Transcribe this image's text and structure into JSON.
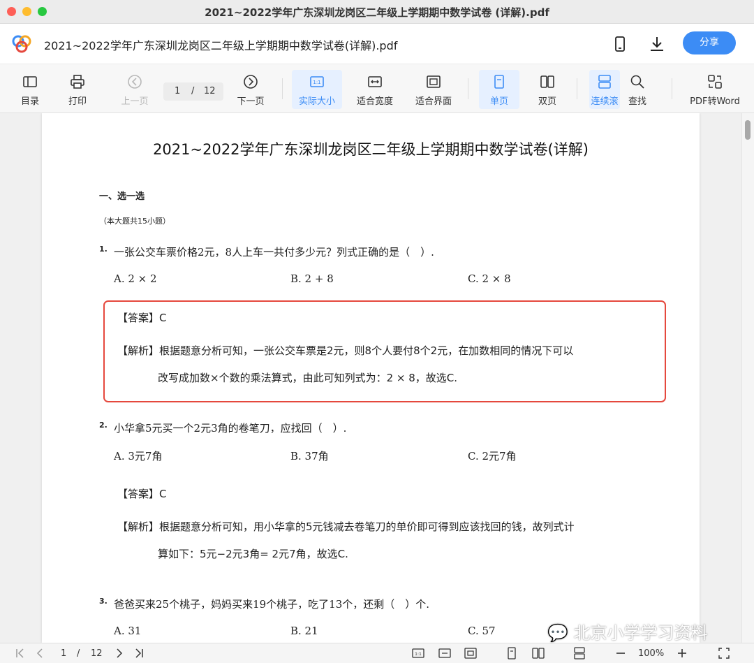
{
  "window": {
    "title": "2021~2022学年广东深圳龙岗区二年级上学期期中数学试卷 (详解).pdf"
  },
  "header": {
    "doc_name": "2021~2022学年广东深圳龙岗区二年级上学期期中数学试卷(详解).pdf",
    "share_label": "分享",
    "accent_color": "#3c8cf5"
  },
  "toolbar": {
    "toc": "目录",
    "print": "打印",
    "prev_page": "上一页",
    "page_current": "1",
    "page_sep": "/",
    "page_total": "12",
    "next_page": "下一页",
    "actual_size": "实际大小",
    "fit_width": "适合宽度",
    "fit_window": "适合界面",
    "single_page": "单页",
    "double_page": "双页",
    "continuous": "连续滚",
    "find": "查找",
    "pdf_to_word": "PDF转Word"
  },
  "document": {
    "title": "2021~2022学年广东深圳龙岗区二年级上学期期中数学试卷(详解)",
    "section_title": "一、选一选",
    "section_note": "（本大题共15小题）",
    "questions": [
      {
        "num": "1.",
        "text": "一张公交车票价格2元，8人上车一共付多少元？列式正确的是（　）.",
        "options": [
          "A. 2 × 2",
          "B. 2 + 8",
          "C. 2 × 8"
        ],
        "answer_label": "【答案】",
        "answer": "C",
        "analysis_label": "【解析】",
        "analysis_line1": "根据题意分析可知，一张公交车票是2元，则8个人要付8个2元，在加数相同的情况下可以",
        "analysis_line2": "改写成加数×个数的乘法算式，由此可知列式为：2 × 8，故选C."
      },
      {
        "num": "2.",
        "text": "小华拿5元买一个2元3角的卷笔刀，应找回（　）.",
        "options": [
          "A. 3元7角",
          "B. 37角",
          "C. 2元7角"
        ],
        "answer_label": "【答案】",
        "answer": "C",
        "analysis_label": "【解析】",
        "analysis_line1": "根据题意分析可知，用小华拿的5元钱减去卷笔刀的单价即可得到应该找回的钱，故列式计",
        "analysis_line2": "算如下：5元−2元3角= 2元7角，故选C."
      },
      {
        "num": "3.",
        "text": "爸爸买来25个桃子，妈妈买来19个桃子，吃了13个，还剩（　）个.",
        "options": [
          "A. 31",
          "B. 21",
          "C. 57"
        ]
      }
    ]
  },
  "statusbar": {
    "page_current": "1",
    "page_sep": "/",
    "page_total": "12",
    "zoom": "100%"
  },
  "watermark": "北京小学学习资料"
}
